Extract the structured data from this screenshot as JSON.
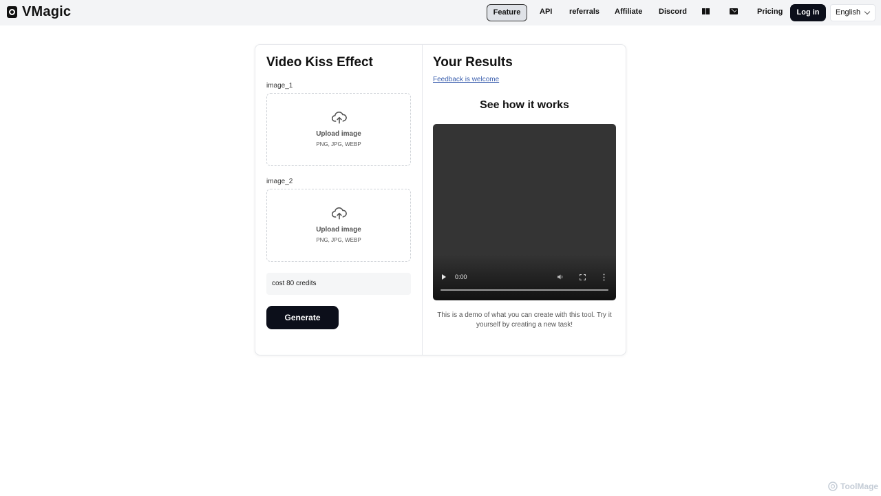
{
  "header": {
    "brand": "VMagic",
    "nav": {
      "feature": "Feature",
      "api": "API",
      "referrals": "referrals",
      "affiliate": "Affiliate",
      "discord": "Discord",
      "pricing": "Pricing"
    },
    "login_label": "Log in",
    "language": "English"
  },
  "left_panel": {
    "title": "Video Kiss Effect",
    "image_1": {
      "label": "image_1",
      "upload_title": "Upload image",
      "formats": "PNG, JPG, WEBP"
    },
    "image_2": {
      "label": "image_2",
      "upload_title": "Upload image",
      "formats": "PNG, JPG, WEBP"
    },
    "cost": "cost 80 credits",
    "generate_label": "Generate"
  },
  "right_panel": {
    "title": "Your Results",
    "feedback_link": "Feedback is welcome",
    "how_title": "See how it works",
    "video": {
      "time": "0:00"
    },
    "demo_text": "This is a demo of what you can create with this tool. Try it yourself by creating a new task!"
  },
  "watermark": "ToolMage",
  "icons": {
    "brand": "brand-logo-icon",
    "docs": "book-icon",
    "mail": "mail-icon",
    "upload": "cloud-upload-icon",
    "language": "chevron-down-icon"
  },
  "colors": {
    "header_bg": "#f3f4f6",
    "primary_button": "#0c0f1a",
    "link": "#3b5fae"
  }
}
